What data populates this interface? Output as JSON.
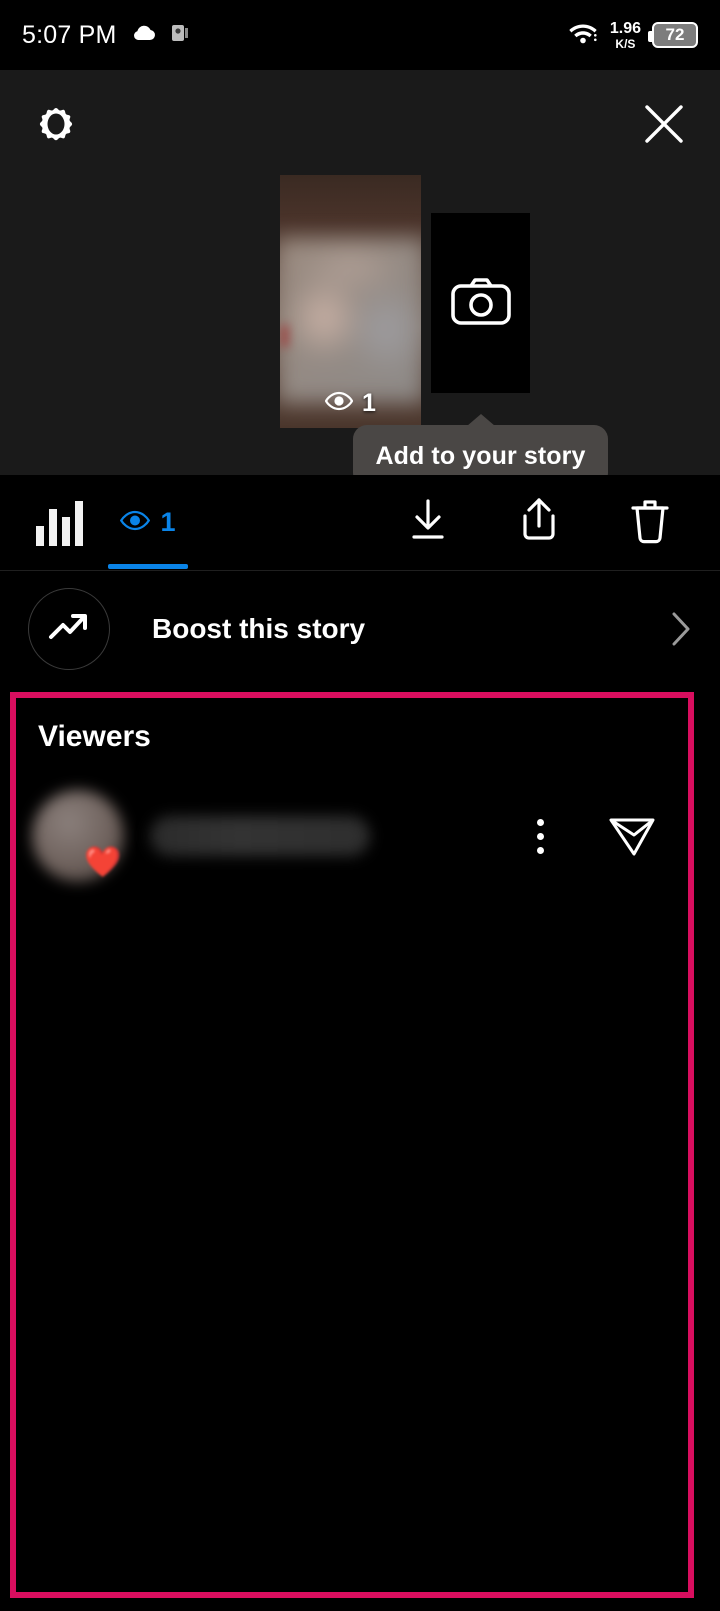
{
  "status_bar": {
    "time": "5:07 PM",
    "cloud_icon": "cloud-icon",
    "app_icon": "app-notification-icon",
    "wifi_icon": "wifi-icon",
    "network_speed_value": "1.96",
    "network_speed_unit": "K/S",
    "battery_level": "72"
  },
  "header": {
    "settings_icon": "gear-icon",
    "close_icon": "close-icon"
  },
  "story": {
    "thumbnail_view_count": "1",
    "thumbnail_view_icon": "eye-icon",
    "camera_tile_icon": "camera-icon",
    "tooltip_text": "Add to your story"
  },
  "action_bar": {
    "insights_tab": "insights-bar-chart-icon",
    "views_tab_icon": "eye-icon",
    "views_count": "1",
    "active_tab": "views",
    "accent_color": "#0a84e8",
    "download_icon": "download-icon",
    "share_icon": "share-icon",
    "delete_icon": "trash-icon"
  },
  "boost": {
    "icon": "trending-up-icon",
    "label": "Boost this story",
    "chevron": "chevron-right-icon"
  },
  "viewers": {
    "title": "Viewers",
    "highlight_border_color": "#d90e5f",
    "rows": [
      {
        "avatar": "viewer-avatar-blurred",
        "reaction_badge": "❤️",
        "username": "",
        "more_icon": "more-options-icon",
        "send_icon": "send-message-icon"
      }
    ]
  }
}
